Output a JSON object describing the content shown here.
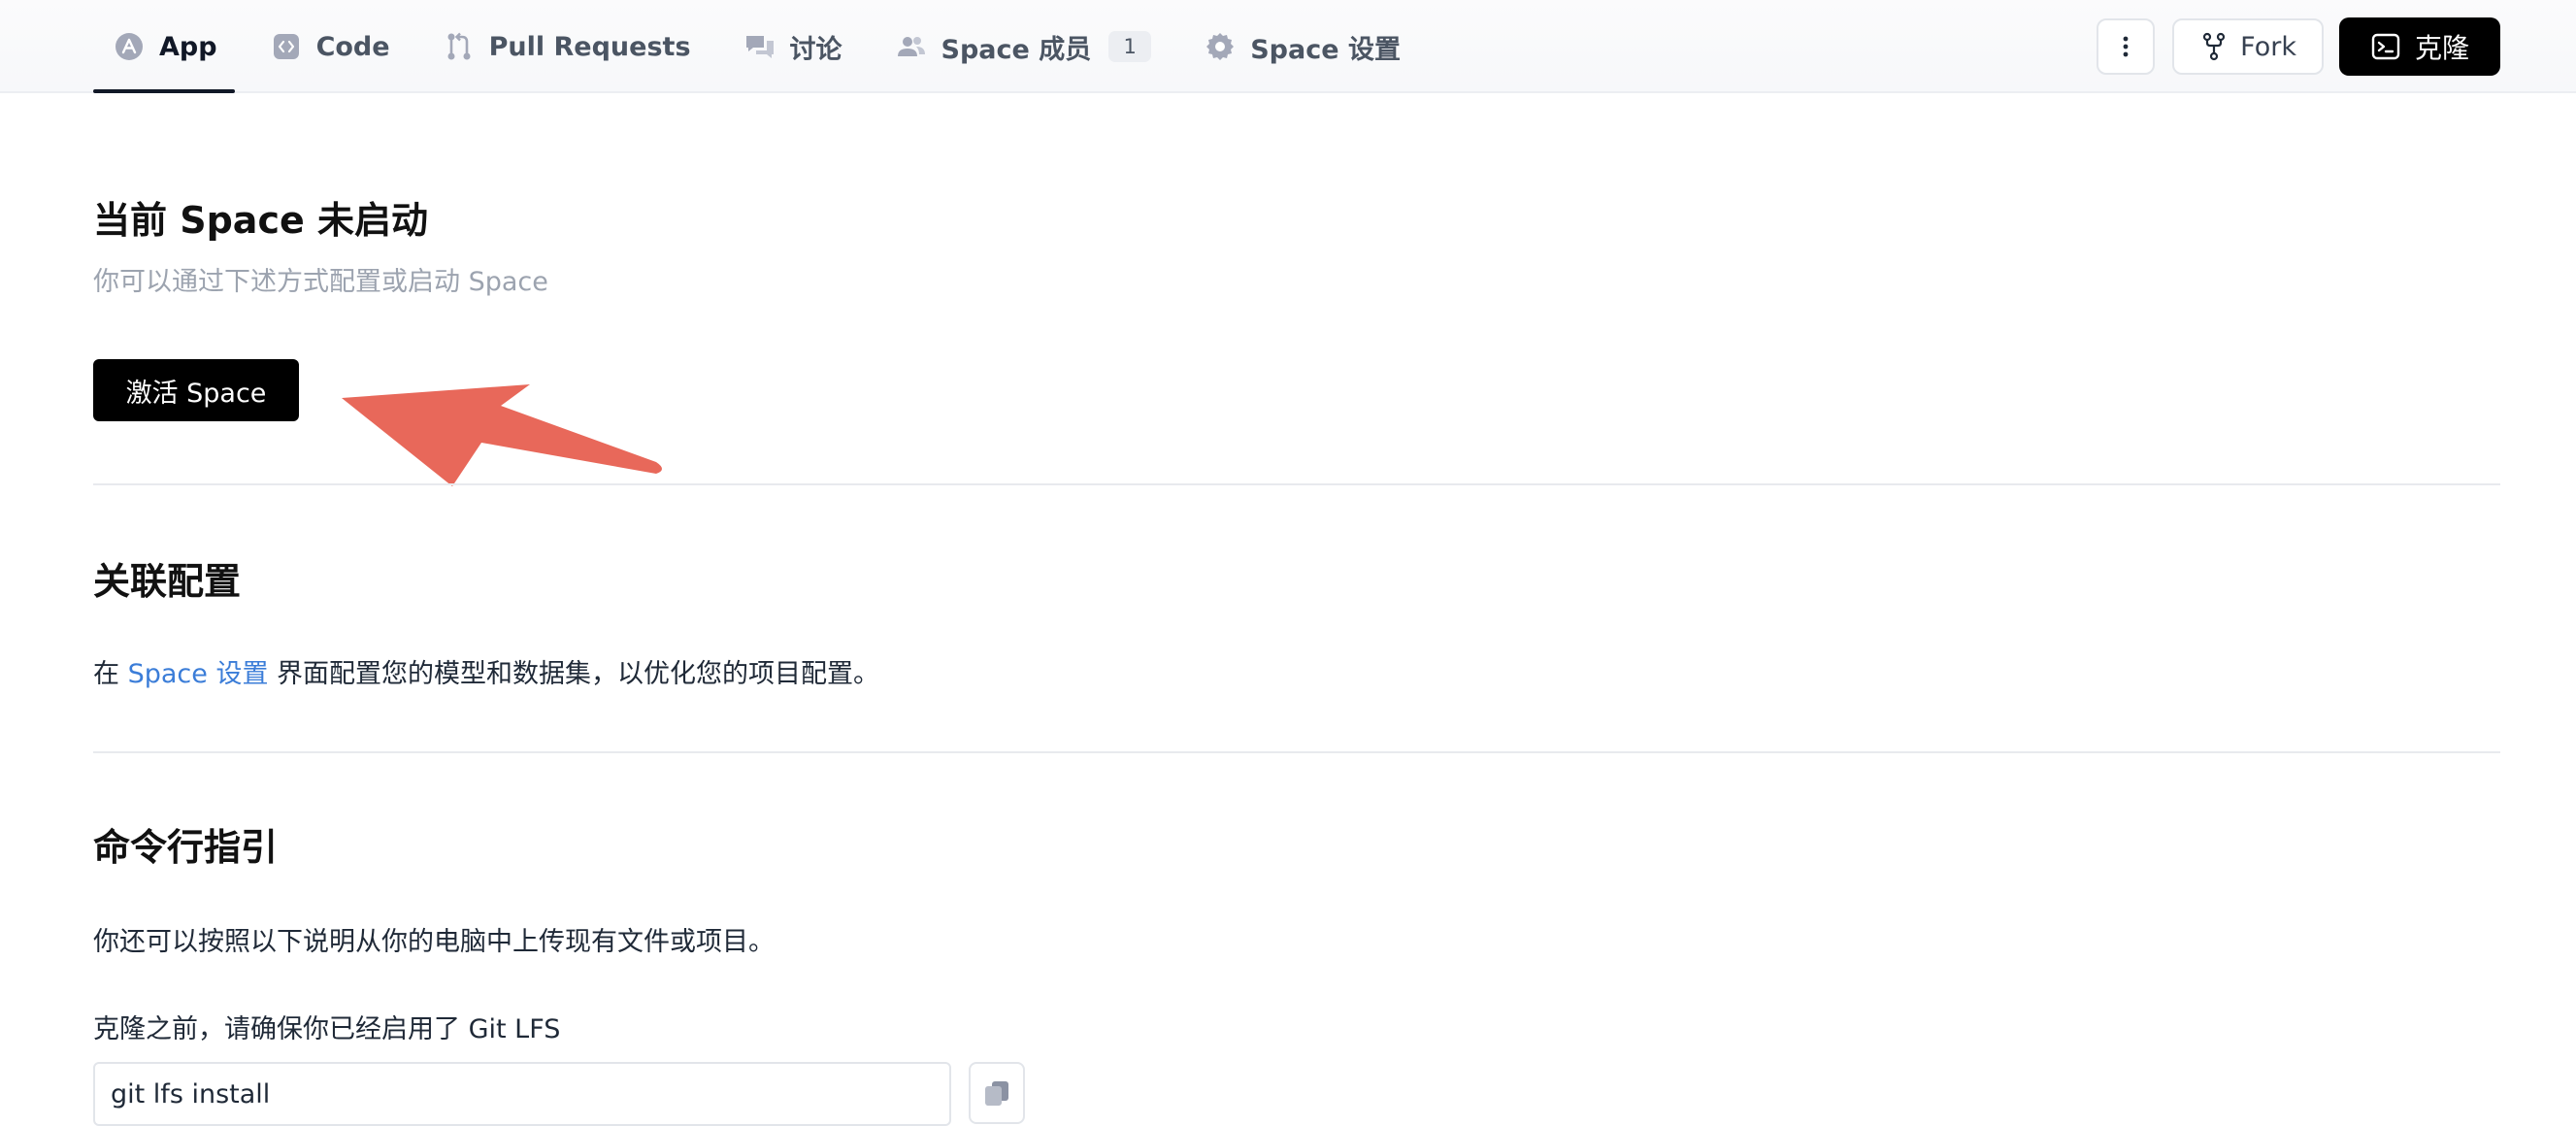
{
  "tabs": [
    {
      "label": "App",
      "icon": "app-icon",
      "active": true
    },
    {
      "label": "Code",
      "icon": "code-icon"
    },
    {
      "label": "Pull Requests",
      "icon": "pull-request-icon"
    },
    {
      "label": "讨论",
      "icon": "discussion-icon"
    },
    {
      "label": "Space 成员",
      "icon": "members-icon",
      "badge": "1"
    },
    {
      "label": "Space 设置",
      "icon": "gear-icon"
    }
  ],
  "actions": {
    "more_icon": "more-vertical-icon",
    "fork_label": "Fork",
    "clone_label": "克隆"
  },
  "status": {
    "title": "当前 Space 未启动",
    "subtitle": "你可以通过下述方式配置或启动 Space",
    "activate_label": "激活 Space"
  },
  "config": {
    "title": "关联配置",
    "prefix": "在 ",
    "link": "Space 设置",
    "suffix": " 界面配置您的模型和数据集，以优化您的项目配置。"
  },
  "cli": {
    "title": "命令行指引",
    "desc": "你还可以按照以下说明从你的电脑中上传现有文件或项目。",
    "lfs_note": "克隆之前，请确保你已经启用了 Git LFS",
    "command": "git lfs install"
  },
  "colors": {
    "accent_link": "#3b7dd8",
    "annotation_arrow": "#e8685a"
  }
}
